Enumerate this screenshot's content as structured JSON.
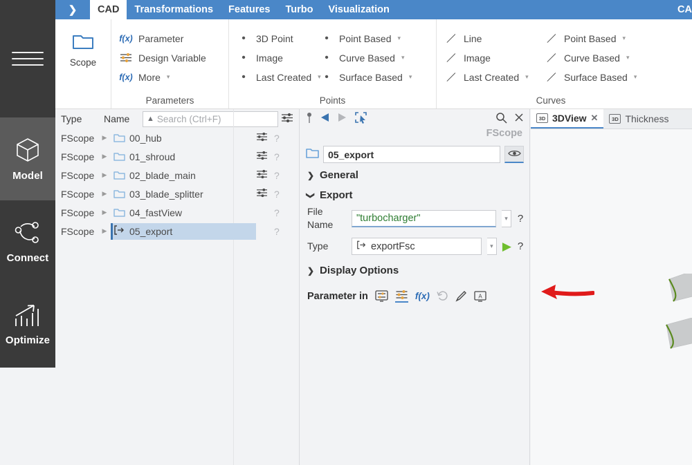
{
  "rail": {
    "menu_icon": "hamburger-icon",
    "items": [
      {
        "label": "Model",
        "icon": "cube-icon",
        "active": true
      },
      {
        "label": "Connect",
        "icon": "nodes-icon",
        "active": false
      },
      {
        "label": "Optimize",
        "icon": "bar-chart-arrow-icon",
        "active": false
      }
    ]
  },
  "ribbon_tabs": {
    "expand_icon": "chevron-right-icon",
    "tabs": [
      "CAD",
      "Transformations",
      "Features",
      "Turbo",
      "Visualization"
    ],
    "active_tab": "CAD",
    "right_tab": "CA"
  },
  "ribbon": {
    "groups": [
      {
        "title": "",
        "big_button": {
          "label": "Scope",
          "icon": "folder-icon"
        }
      },
      {
        "title": "Parameters",
        "items": [
          {
            "label": "Parameter",
            "icon": "fx-icon",
            "caret": false
          },
          {
            "label": "Design Variable",
            "icon": "sliders-icon",
            "caret": false
          },
          {
            "label": "More",
            "icon": "fx-icon",
            "caret": true
          }
        ]
      },
      {
        "title": "Points",
        "columns": [
          [
            {
              "label": "3D Point",
              "icon": "dot-icon",
              "caret": false
            },
            {
              "label": "Image",
              "icon": "dot-icon",
              "caret": false
            },
            {
              "label": "Last Created",
              "icon": "dot-icon",
              "caret": true
            }
          ],
          [
            {
              "label": "Point Based",
              "icon": "dot-icon",
              "caret": true
            },
            {
              "label": "Curve Based",
              "icon": "dot-icon",
              "caret": true
            },
            {
              "label": "Surface Based",
              "icon": "dot-icon",
              "caret": true
            }
          ]
        ]
      },
      {
        "title": "Curves",
        "columns": [
          [
            {
              "label": "Line",
              "icon": "line-icon",
              "caret": false
            },
            {
              "label": "Image",
              "icon": "line-icon",
              "caret": false
            },
            {
              "label": "Last Created",
              "icon": "line-icon",
              "caret": true
            }
          ],
          [
            {
              "label": "Point Based",
              "icon": "line-icon",
              "caret": true
            },
            {
              "label": "Curve Based",
              "icon": "line-icon",
              "caret": true
            },
            {
              "label": "Surface Based",
              "icon": "line-icon",
              "caret": true
            }
          ]
        ]
      }
    ]
  },
  "tree": {
    "headers": {
      "type": "Type",
      "name": "Name"
    },
    "search": {
      "placeholder": "Search (Ctrl+F)",
      "value": "",
      "sort_icon": "caret-up-icon",
      "filter_icon": "sliders-icon"
    },
    "rows": [
      {
        "type": "FScope",
        "name": "00_hub",
        "icon": "folder-icon",
        "sliders": true,
        "help": "?",
        "selected": false
      },
      {
        "type": "FScope",
        "name": "01_shroud",
        "icon": "folder-icon",
        "sliders": true,
        "help": "?",
        "selected": false
      },
      {
        "type": "FScope",
        "name": "02_blade_main",
        "icon": "folder-icon",
        "sliders": true,
        "help": "?",
        "selected": false
      },
      {
        "type": "FScope",
        "name": "03_blade_splitter",
        "icon": "folder-icon",
        "sliders": true,
        "help": "?",
        "selected": false
      },
      {
        "type": "FScope",
        "name": "04_fastView",
        "icon": "folder-icon",
        "sliders": false,
        "help": "?",
        "selected": false
      },
      {
        "type": "FScope",
        "name": "05_export",
        "icon": "export-icon",
        "sliders": false,
        "help": "?",
        "selected": true
      }
    ]
  },
  "props": {
    "toolbar": {
      "pin": "pin-icon",
      "back": "back-triangle-icon",
      "forward": "forward-triangle-icon",
      "pick": "pick-cursor-icon",
      "search": "search-icon",
      "close": "close-icon"
    },
    "subtitle": "FScope",
    "name_value": "05_export",
    "name_icon": "folder-icon",
    "visibility_icon": "eye-icon",
    "sections": {
      "general": {
        "label": "General",
        "expanded": false
      },
      "export": {
        "label": "Export",
        "expanded": true
      },
      "display_options": {
        "label": "Display Options",
        "expanded": false
      }
    },
    "fields": [
      {
        "label": "File Name",
        "value": "\"turbocharger\"",
        "help": "?",
        "has_play": false
      },
      {
        "label": "Type",
        "value": "exportFsc",
        "icon": "export-icon",
        "help": "?",
        "has_play": true,
        "play_icon": "play-icon"
      }
    ],
    "parameter_row": {
      "label": "Parameter in",
      "icons": [
        {
          "name": "monitor-sliders-icon",
          "active": false
        },
        {
          "name": "sliders-icon",
          "active": true
        },
        {
          "name": "fx-icon",
          "active": false
        },
        {
          "name": "undo-icon",
          "active": false
        },
        {
          "name": "pencil-icon",
          "active": false
        },
        {
          "name": "annotation-a-icon",
          "active": false
        }
      ]
    }
  },
  "view": {
    "tabs": [
      {
        "label": "3DView",
        "icon": "3d-icon",
        "active": true,
        "closable": true
      },
      {
        "label": "Thickness",
        "icon": "3d-icon",
        "active": false,
        "closable": false
      }
    ],
    "annotation": {
      "type": "arrow",
      "direction": "left",
      "color": "#e01b1b"
    },
    "geometry": {
      "shapes": "blade-surfaces",
      "fill": "#c9cbcc",
      "edge": "#5a8a1e"
    }
  },
  "colors": {
    "ribbon_blue": "#4a87c8",
    "rail_dark": "#3a3a3a",
    "rail_active": "#5b5b5b",
    "selection": "#c3d6ea",
    "accent_green": "#6fbe2e",
    "value_green": "#2e7d32",
    "annotation_red": "#e01b1b"
  }
}
